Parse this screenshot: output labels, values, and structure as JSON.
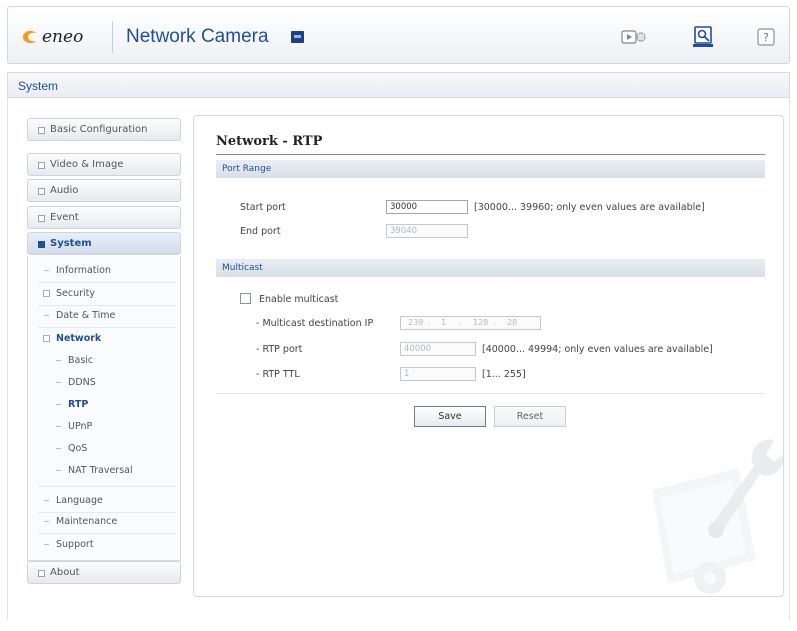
{
  "header": {
    "logo_text": "eneo",
    "product_title": "Network Camera",
    "icons": [
      "live-view-icon",
      "setup-icon",
      "help-icon"
    ]
  },
  "tabbar": {
    "active_tab": "System"
  },
  "sidebar": {
    "items": [
      {
        "label": "Basic Configuration"
      },
      {
        "label": "Video & Image"
      },
      {
        "label": "Audio"
      },
      {
        "label": "Event"
      },
      {
        "label": "System",
        "active": true
      },
      {
        "label": "About"
      }
    ],
    "submenu": [
      {
        "label": "Information"
      },
      {
        "label": "Security"
      },
      {
        "label": "Date & Time"
      },
      {
        "label": "Network"
      },
      {
        "label": "Basic"
      },
      {
        "label": "DDNS"
      },
      {
        "label": "RTP"
      },
      {
        "label": "UPnP"
      },
      {
        "label": "QoS"
      },
      {
        "label": "NAT Traversal"
      },
      {
        "label": "Language"
      },
      {
        "label": "Maintenance"
      },
      {
        "label": "Support"
      }
    ]
  },
  "content": {
    "title": "Network - RTP",
    "port_range": {
      "section_label": "Port Range",
      "start_port_label": "Start port",
      "start_port_value": "30000",
      "start_port_hint": "[30000... 39960; only even values are available]",
      "end_port_label": "End port",
      "end_port_value": "39040"
    },
    "multicast": {
      "section_label": "Multicast",
      "enable_label": "Enable multicast",
      "enabled": false,
      "dest_ip_label": "- Multicast destination IP",
      "dest_ip": [
        "239",
        "1",
        "128",
        "28"
      ],
      "rtp_port_label": "- RTP port",
      "rtp_port_value": "40000",
      "rtp_port_hint": "[40000... 49994; only even values are available]",
      "rtp_ttl_label": "- RTP TTL",
      "rtp_ttl_value": "1",
      "rtp_ttl_hint": "[1... 255]"
    },
    "buttons": {
      "save": "Save",
      "reset": "Reset"
    }
  },
  "colors": {
    "accent": "#1f4f9a",
    "logo_orange": "#f29b1d"
  }
}
